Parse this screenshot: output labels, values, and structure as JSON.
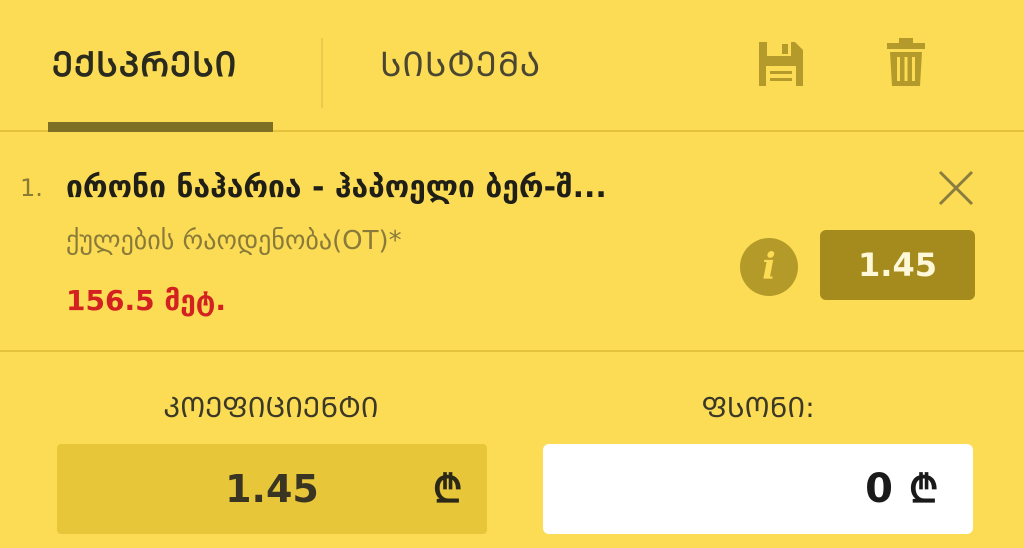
{
  "tabs": [
    {
      "label": "ᲔᲥᲡᲞᲠᲔᲡᲘ",
      "active": true
    },
    {
      "label": "ᲡᲘᲡᲢᲔᲛᲐ",
      "active": false
    }
  ],
  "icons": {
    "save": "save-icon",
    "trash": "trash-icon",
    "close": "close-icon",
    "info": "info-icon",
    "currency": "lari-icon"
  },
  "bet": {
    "index": "1.",
    "title": "ირონი ნაჰარია - ჰაპოელი ბერ-შ...",
    "market": "ქულების რაოდენობა(OT)*",
    "amount": "156.5 მეტ.",
    "odds": "1.45",
    "info_glyph": "i"
  },
  "fields": {
    "coefficient_label": "ᲙᲝᲔᲤᲘᲪᲘᲔᲜᲢᲘ",
    "coefficient_value": "1.45",
    "stake_label": "ᲤᲡᲝᲜᲘ:",
    "stake_value": "0",
    "currency_symbol": "₾"
  },
  "colors": {
    "background": "#fbdc54",
    "accent": "#a58b1e",
    "amount": "#d32020"
  }
}
